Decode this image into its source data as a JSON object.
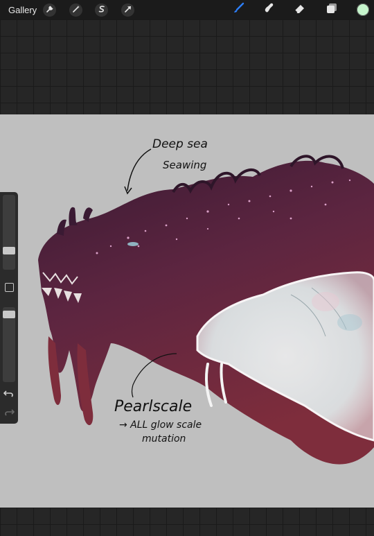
{
  "toolbar": {
    "gallery_label": "Gallery",
    "left_tools": [
      "wrench-icon",
      "magic-wand-icon",
      "selection-s-icon",
      "transform-arrow-icon"
    ],
    "right_tools": [
      "brush-icon",
      "smudge-icon",
      "eraser-icon",
      "layers-icon"
    ],
    "active_tool": "brush-icon",
    "accent_color": "#2d7ff9",
    "current_color": "#c6f5cc"
  },
  "sidebar": {
    "brush_size": 0.23,
    "opacity": 0.95
  },
  "canvas": {
    "background_color": "#bfbfbf",
    "annotation_top_line1": "Deep sea",
    "annotation_top_line2": "Seawing",
    "annotation_bottom_line1": "Pearlscale",
    "annotation_bottom_line2": "→ ALL glow scale",
    "annotation_bottom_line3": "mutation"
  }
}
